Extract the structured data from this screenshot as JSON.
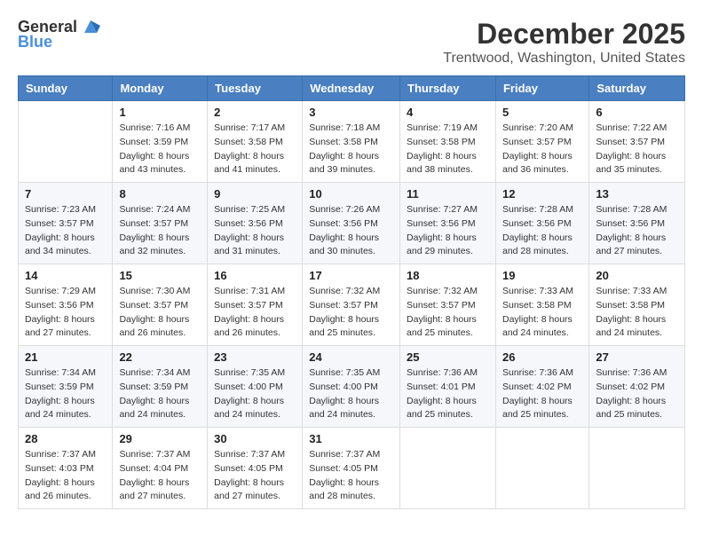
{
  "logo": {
    "general": "General",
    "blue": "Blue"
  },
  "title": "December 2025",
  "location": "Trentwood, Washington, United States",
  "headers": [
    "Sunday",
    "Monday",
    "Tuesday",
    "Wednesday",
    "Thursday",
    "Friday",
    "Saturday"
  ],
  "weeks": [
    [
      {
        "day": "",
        "info": ""
      },
      {
        "day": "1",
        "info": "Sunrise: 7:16 AM\nSunset: 3:59 PM\nDaylight: 8 hours\nand 43 minutes."
      },
      {
        "day": "2",
        "info": "Sunrise: 7:17 AM\nSunset: 3:58 PM\nDaylight: 8 hours\nand 41 minutes."
      },
      {
        "day": "3",
        "info": "Sunrise: 7:18 AM\nSunset: 3:58 PM\nDaylight: 8 hours\nand 39 minutes."
      },
      {
        "day": "4",
        "info": "Sunrise: 7:19 AM\nSunset: 3:58 PM\nDaylight: 8 hours\nand 38 minutes."
      },
      {
        "day": "5",
        "info": "Sunrise: 7:20 AM\nSunset: 3:57 PM\nDaylight: 8 hours\nand 36 minutes."
      },
      {
        "day": "6",
        "info": "Sunrise: 7:22 AM\nSunset: 3:57 PM\nDaylight: 8 hours\nand 35 minutes."
      }
    ],
    [
      {
        "day": "7",
        "info": "Sunrise: 7:23 AM\nSunset: 3:57 PM\nDaylight: 8 hours\nand 34 minutes."
      },
      {
        "day": "8",
        "info": "Sunrise: 7:24 AM\nSunset: 3:57 PM\nDaylight: 8 hours\nand 32 minutes."
      },
      {
        "day": "9",
        "info": "Sunrise: 7:25 AM\nSunset: 3:56 PM\nDaylight: 8 hours\nand 31 minutes."
      },
      {
        "day": "10",
        "info": "Sunrise: 7:26 AM\nSunset: 3:56 PM\nDaylight: 8 hours\nand 30 minutes."
      },
      {
        "day": "11",
        "info": "Sunrise: 7:27 AM\nSunset: 3:56 PM\nDaylight: 8 hours\nand 29 minutes."
      },
      {
        "day": "12",
        "info": "Sunrise: 7:28 AM\nSunset: 3:56 PM\nDaylight: 8 hours\nand 28 minutes."
      },
      {
        "day": "13",
        "info": "Sunrise: 7:28 AM\nSunset: 3:56 PM\nDaylight: 8 hours\nand 27 minutes."
      }
    ],
    [
      {
        "day": "14",
        "info": "Sunrise: 7:29 AM\nSunset: 3:56 PM\nDaylight: 8 hours\nand 27 minutes."
      },
      {
        "day": "15",
        "info": "Sunrise: 7:30 AM\nSunset: 3:57 PM\nDaylight: 8 hours\nand 26 minutes."
      },
      {
        "day": "16",
        "info": "Sunrise: 7:31 AM\nSunset: 3:57 PM\nDaylight: 8 hours\nand 26 minutes."
      },
      {
        "day": "17",
        "info": "Sunrise: 7:32 AM\nSunset: 3:57 PM\nDaylight: 8 hours\nand 25 minutes."
      },
      {
        "day": "18",
        "info": "Sunrise: 7:32 AM\nSunset: 3:57 PM\nDaylight: 8 hours\nand 25 minutes."
      },
      {
        "day": "19",
        "info": "Sunrise: 7:33 AM\nSunset: 3:58 PM\nDaylight: 8 hours\nand 24 minutes."
      },
      {
        "day": "20",
        "info": "Sunrise: 7:33 AM\nSunset: 3:58 PM\nDaylight: 8 hours\nand 24 minutes."
      }
    ],
    [
      {
        "day": "21",
        "info": "Sunrise: 7:34 AM\nSunset: 3:59 PM\nDaylight: 8 hours\nand 24 minutes."
      },
      {
        "day": "22",
        "info": "Sunrise: 7:34 AM\nSunset: 3:59 PM\nDaylight: 8 hours\nand 24 minutes."
      },
      {
        "day": "23",
        "info": "Sunrise: 7:35 AM\nSunset: 4:00 PM\nDaylight: 8 hours\nand 24 minutes."
      },
      {
        "day": "24",
        "info": "Sunrise: 7:35 AM\nSunset: 4:00 PM\nDaylight: 8 hours\nand 24 minutes."
      },
      {
        "day": "25",
        "info": "Sunrise: 7:36 AM\nSunset: 4:01 PM\nDaylight: 8 hours\nand 25 minutes."
      },
      {
        "day": "26",
        "info": "Sunrise: 7:36 AM\nSunset: 4:02 PM\nDaylight: 8 hours\nand 25 minutes."
      },
      {
        "day": "27",
        "info": "Sunrise: 7:36 AM\nSunset: 4:02 PM\nDaylight: 8 hours\nand 25 minutes."
      }
    ],
    [
      {
        "day": "28",
        "info": "Sunrise: 7:37 AM\nSunset: 4:03 PM\nDaylight: 8 hours\nand 26 minutes."
      },
      {
        "day": "29",
        "info": "Sunrise: 7:37 AM\nSunset: 4:04 PM\nDaylight: 8 hours\nand 27 minutes."
      },
      {
        "day": "30",
        "info": "Sunrise: 7:37 AM\nSunset: 4:05 PM\nDaylight: 8 hours\nand 27 minutes."
      },
      {
        "day": "31",
        "info": "Sunrise: 7:37 AM\nSunset: 4:05 PM\nDaylight: 8 hours\nand 28 minutes."
      },
      {
        "day": "",
        "info": ""
      },
      {
        "day": "",
        "info": ""
      },
      {
        "day": "",
        "info": ""
      }
    ]
  ]
}
